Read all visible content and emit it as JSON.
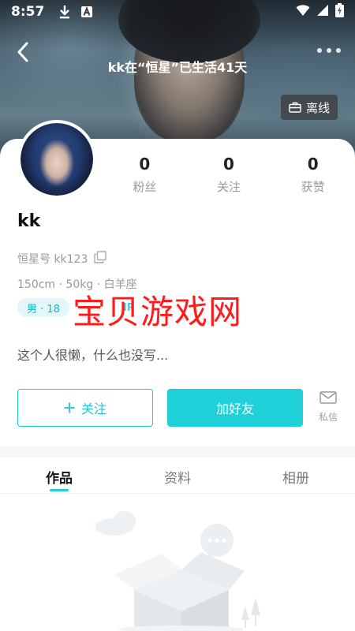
{
  "status_bar": {
    "time": "8:57",
    "icons": [
      "download-icon",
      "a-badge-icon"
    ],
    "right_icons": [
      "wifi-icon",
      "signal-icon",
      "battery-charging-icon"
    ]
  },
  "header": {
    "title": "kk在“恒星”已生活41天",
    "back_icon": "back-arrow-icon",
    "more_icon": "more-dots-icon",
    "offline_label": "离线"
  },
  "profile": {
    "username": "kk",
    "id_label": "恒星号 kk123",
    "body_info": "150cm · 50kg · 白羊座",
    "gender_age": "男 · 18",
    "vip_text": "IP",
    "bio": "这个人很懒，什么也没写..."
  },
  "stats": [
    {
      "value": "0",
      "label": "粉丝"
    },
    {
      "value": "0",
      "label": "关注"
    },
    {
      "value": "0",
      "label": "获赞"
    }
  ],
  "actions": {
    "follow_label": "关注",
    "add_friend_label": "加好友",
    "message_label": "私信"
  },
  "tabs": [
    {
      "label": "作品",
      "active": true
    },
    {
      "label": "资料",
      "active": false
    },
    {
      "label": "相册",
      "active": false
    }
  ],
  "watermark": "宝贝游戏网",
  "colors": {
    "accent": "#1fd0d8",
    "watermark": "#ff1b1b"
  }
}
